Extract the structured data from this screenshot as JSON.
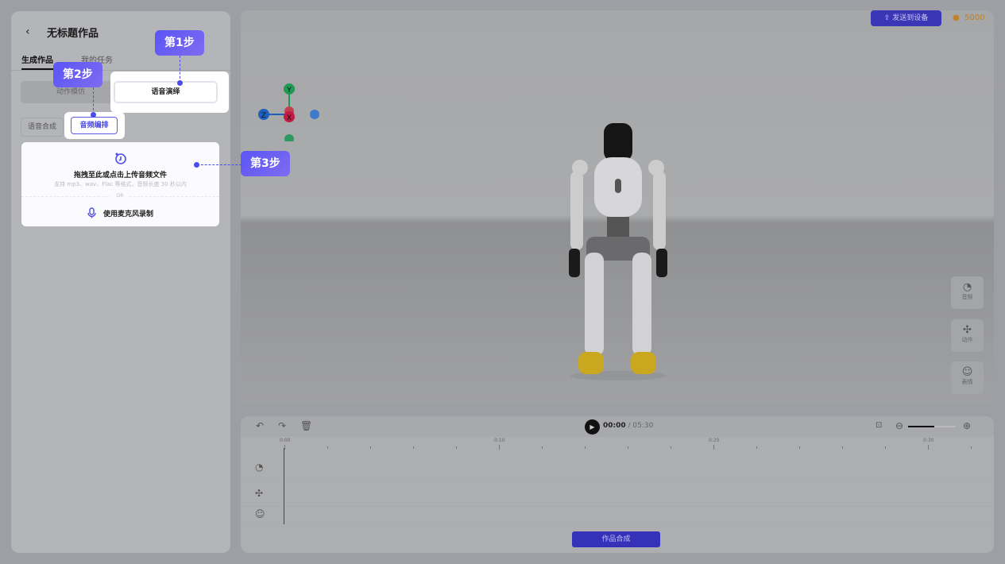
{
  "header": {
    "back_icon": "chevron-left-icon",
    "title": "无标题作品"
  },
  "tabs": [
    {
      "label": "生成作品",
      "active": true
    },
    {
      "label": "我的任务",
      "active": false
    }
  ],
  "mode_tabs": [
    {
      "label": "动作模仿"
    },
    {
      "label": "语音演绎",
      "active": true
    }
  ],
  "sub_tabs": [
    {
      "label": "语音合成"
    },
    {
      "label": "音频编排",
      "active": true
    }
  ],
  "upload": {
    "title": "拖拽至此或点击上传音频文件",
    "hint": "支持 mp3、wav、Flac 等格式，音频长度 30 秒以内",
    "or": "OR",
    "mic_label": "使用麦克风录制"
  },
  "steps": [
    "第1步",
    "第2步",
    "第3步"
  ],
  "viewport": {
    "send_button": "发送到设备",
    "coins": "5000",
    "axes": [
      "Y",
      "Z",
      "X"
    ],
    "side_buttons": [
      {
        "label": "音频",
        "icon": "audio-icon"
      },
      {
        "label": "动作",
        "icon": "motion-icon"
      },
      {
        "label": "表情",
        "icon": "face-icon"
      }
    ]
  },
  "timeline": {
    "current": "00:00",
    "total": "/ 05:30",
    "ticks": [
      "0:00",
      "0:10",
      "0:20",
      "0:30"
    ],
    "zoom_level": 0.55,
    "compose_button": "作品合成"
  },
  "colors": {
    "accent": "#5a55f5",
    "button": "#3a36b6",
    "coin": "#c0812c"
  }
}
